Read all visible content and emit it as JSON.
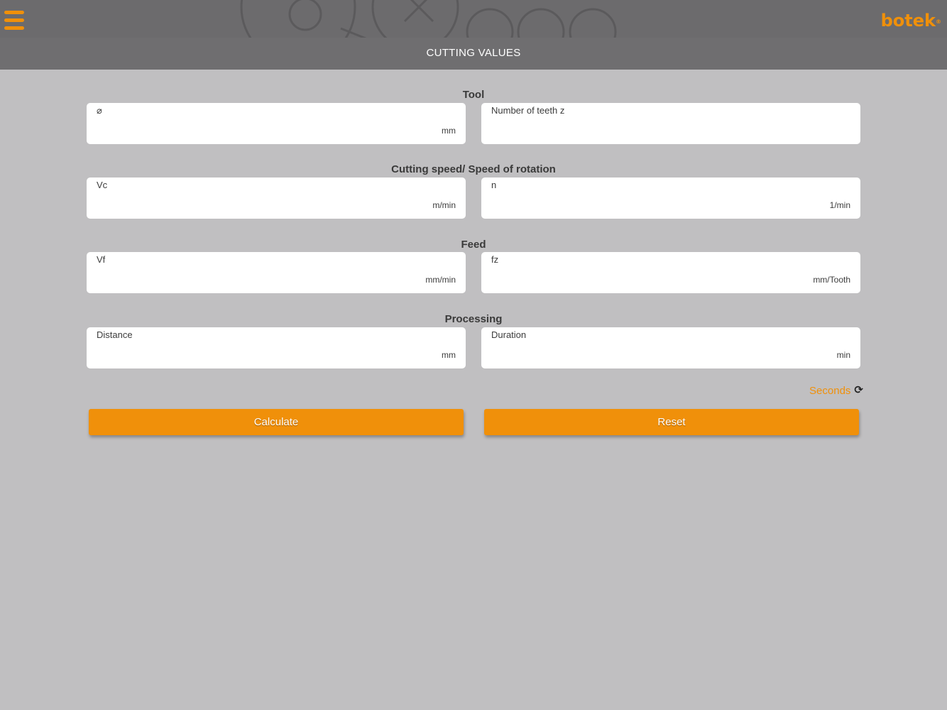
{
  "header": {
    "brand": "botek",
    "brand_mark": "®",
    "menu_icon": "hamburger-menu-icon",
    "title": "CUTTING VALUES"
  },
  "sections": {
    "tool": {
      "title": "Tool",
      "diameter": {
        "label": "⌀",
        "unit": "mm",
        "value": ""
      },
      "teeth": {
        "label": "Number of teeth z",
        "unit": "",
        "value": ""
      }
    },
    "speed": {
      "title": "Cutting speed/ Speed of rotation",
      "vc": {
        "label": "Vc",
        "unit": "m/min",
        "value": ""
      },
      "n": {
        "label": "n",
        "unit": "1/min",
        "value": ""
      }
    },
    "feed": {
      "title": "Feed",
      "vf": {
        "label": "Vf",
        "unit": "mm/min",
        "value": ""
      },
      "fz": {
        "label": "fz",
        "unit": "mm/Tooth",
        "value": ""
      }
    },
    "processing": {
      "title": "Processing",
      "distance": {
        "label": "Distance",
        "unit": "mm",
        "value": ""
      },
      "duration": {
        "label": "Duration",
        "unit": "min",
        "value": ""
      }
    }
  },
  "toggle": {
    "label": "Seconds",
    "icon": "refresh-icon"
  },
  "buttons": {
    "calculate": "Calculate",
    "reset": "Reset"
  },
  "colors": {
    "accent": "#f0900a",
    "background": "#c0bfc1",
    "header": "#6c6b6d"
  }
}
